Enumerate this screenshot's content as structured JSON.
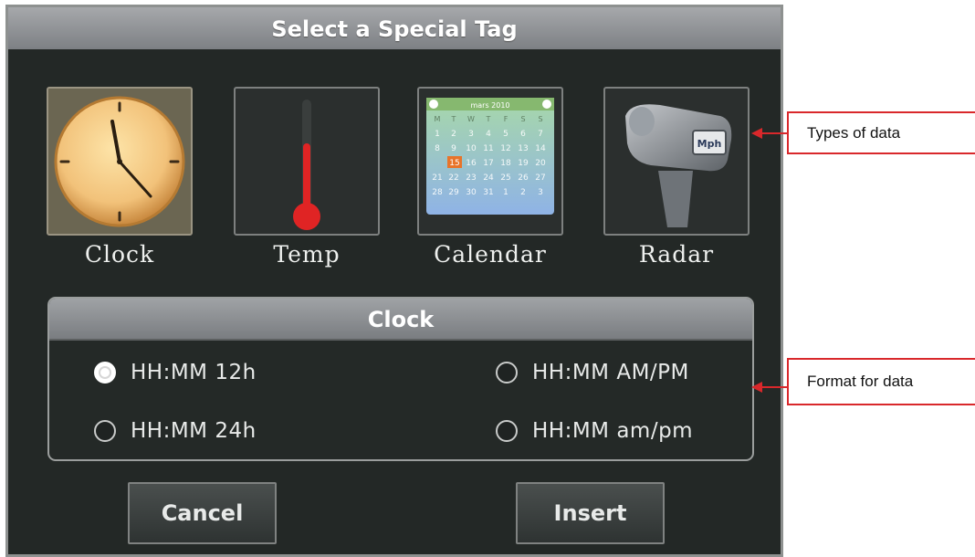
{
  "dialog": {
    "title": "Select a Special Tag",
    "tag_types": [
      {
        "label": "Clock",
        "icon": "clock-icon",
        "selected": true
      },
      {
        "label": "Temp",
        "icon": "thermometer-icon",
        "selected": false
      },
      {
        "label": "Calendar",
        "icon": "calendar-icon",
        "selected": false
      },
      {
        "label": "Radar",
        "icon": "radar-gun-icon",
        "selected": false
      }
    ],
    "calendar_icon": {
      "month": "mars 2010",
      "weekdays": [
        "M",
        "T",
        "W",
        "T",
        "F",
        "S",
        "S"
      ],
      "highlight_day": "15"
    },
    "radar_icon": {
      "text": "Mph"
    },
    "format_panel": {
      "title": "Clock",
      "options": [
        {
          "label": "HH:MM 12h",
          "checked": true
        },
        {
          "label": "HH:MM AM/PM",
          "checked": false
        },
        {
          "label": "HH:MM 24h",
          "checked": false
        },
        {
          "label": "HH:MM am/pm",
          "checked": false
        }
      ]
    },
    "buttons": {
      "cancel": "Cancel",
      "insert": "Insert"
    }
  },
  "annotations": {
    "types": "Types of data",
    "format": "Format for data"
  },
  "colors": {
    "dialog_bg": "#232826",
    "selected_tile": "#6b6652",
    "callout_border": "#d9282b"
  }
}
